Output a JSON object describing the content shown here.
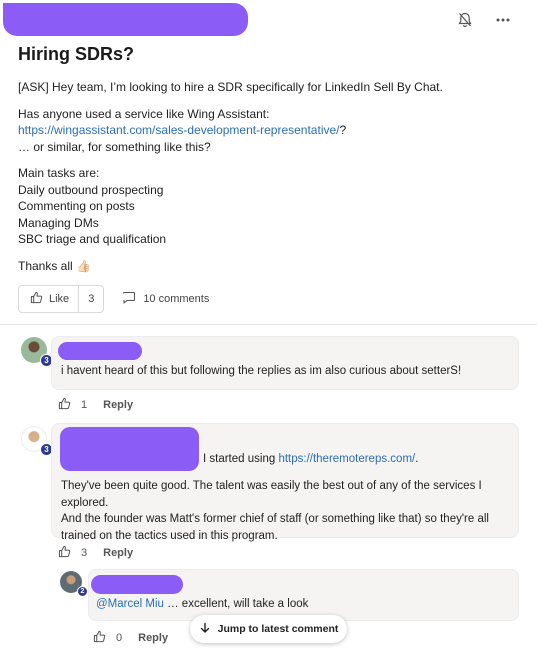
{
  "post": {
    "title": "Hiring SDRs?",
    "paragraph1": "[ASK] Hey team, I’m looking to hire a SDR specifically for LinkedIn Sell By Chat.",
    "para2_line1": "Has anyone used a service like Wing Assistant:",
    "para2_link": "https://wingassistant.com/sales-development-representative/",
    "para2_link_suffix": "?",
    "para2_line3": "… or similar, for something like this?",
    "tasks_heading": "Main tasks are:",
    "tasks": [
      "Daily outbound prospecting",
      "Commenting on posts",
      "Managing DMs",
      "SBC triage and qualification"
    ],
    "thanks": "Thanks all 👍🏻"
  },
  "actions": {
    "like_label": "Like",
    "like_count": "3",
    "comments_label": "10 comments"
  },
  "comments": [
    {
      "badge": "3",
      "text": "i havent heard of this but following the replies as im also curious about setterS!",
      "like_count": "1",
      "reply_label": "Reply",
      "avatar_color": "#7a9a7c"
    },
    {
      "badge": "3",
      "text_prefix": "I started using ",
      "link": "https://theremotereps.com/",
      "text_suffix": ".",
      "text2_l1": "They've been quite good. The talent was easily the best out of any of the services I explored.",
      "text2_l2": "And the founder was Matt's former chief of staff (or something like that) so they're all",
      "text2_l3": "trained on the tactics used in this program.",
      "like_count": "3",
      "reply_label": "Reply",
      "avatar_color": "#c9a27e"
    },
    {
      "badge": "2",
      "mention": "@Marcel Miu",
      "text": " … excellent, will take a look",
      "like_count": "0",
      "reply_label": "Reply",
      "avatar_color": "#6b7a86"
    }
  ],
  "jump_label": "Jump to latest comment",
  "colors": {
    "redaction": "#8b5cf6",
    "link": "#2a6ebb",
    "badge": "#2d3b8f"
  }
}
